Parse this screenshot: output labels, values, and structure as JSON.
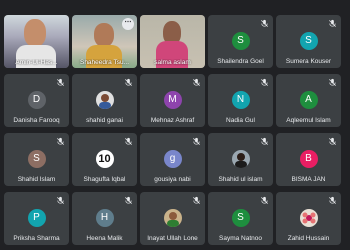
{
  "row1": {
    "tile1": {
      "name": "Amin-Ul-Has..."
    },
    "tile2": {
      "name": "Shaheedra Tsu..."
    },
    "tile3": {
      "name": "salma aslam"
    },
    "tile4": {
      "name": "Shailendra Goel",
      "initial": "S",
      "color": "#1e8e3e"
    },
    "tile5": {
      "name": "Sumera Kouser",
      "initial": "S",
      "color": "#12a4af"
    }
  },
  "row2": {
    "tile1": {
      "name": "Danisha Farooq",
      "initial": "D",
      "color": "#5f6368"
    },
    "tile2": {
      "name": "shahid ganai"
    },
    "tile3": {
      "name": "Mehnaz Ashraf",
      "initial": "M",
      "color": "#8e44ad"
    },
    "tile4": {
      "name": "Nadia Gul",
      "initial": "N",
      "color": "#12a4af"
    },
    "tile5": {
      "name": "Aqleemul Islam",
      "initial": "A",
      "color": "#1e8e3e"
    }
  },
  "row3": {
    "tile1": {
      "name": "Shahid Islam",
      "initial": "S",
      "color": "#8d6e63"
    },
    "tile2": {
      "name": "Shagufta Iqbal",
      "initial": "10"
    },
    "tile3": {
      "name": "gousiya nabi",
      "initial": "g",
      "color": "#7986cb"
    },
    "tile4": {
      "name": "Shahid ul islam"
    },
    "tile5": {
      "name": "BISMA JAN",
      "initial": "B",
      "color": "#e91e63"
    }
  },
  "row4": {
    "tile1": {
      "name": "Priksha Sharma",
      "initial": "P",
      "color": "#12a4af"
    },
    "tile2": {
      "name": "Heena Malik",
      "initial": "H",
      "color": "#5f7d8c"
    },
    "tile3": {
      "name": "Inayat Ullah Lone"
    },
    "tile4": {
      "name": "Sayma Natnoo",
      "initial": "S",
      "color": "#1e8e3e"
    },
    "tile5": {
      "name": "Zahid Hussain"
    }
  }
}
